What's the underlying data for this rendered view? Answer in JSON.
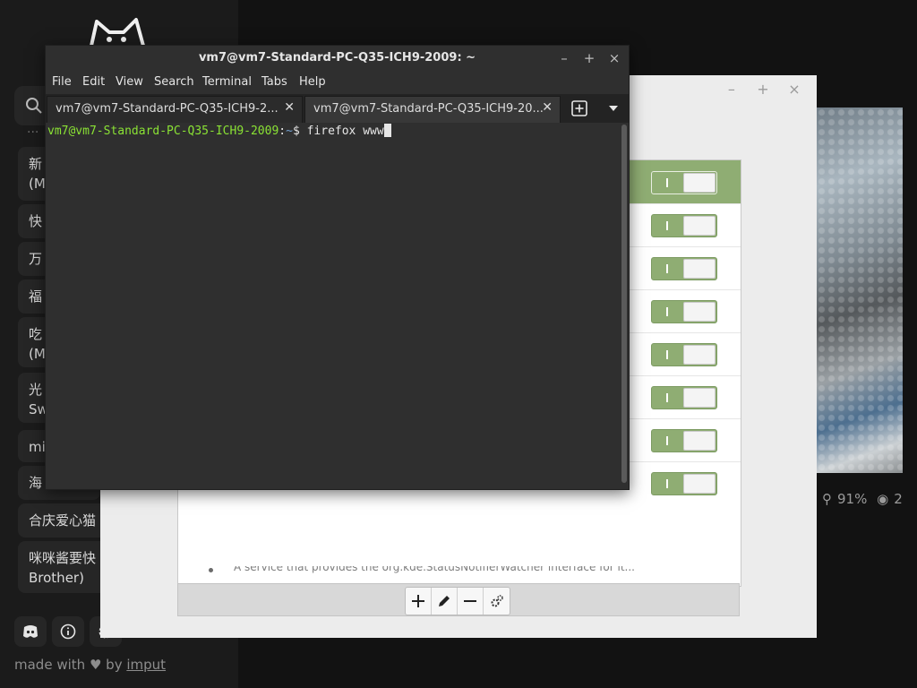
{
  "background_app": {
    "search_hint": "...",
    "sidebar_items": [
      {
        "label": "新\n(M"
      },
      {
        "label": "快"
      },
      {
        "label": "万"
      },
      {
        "label": "福"
      },
      {
        "label": "吃\n(M"
      },
      {
        "label": "光\nSw"
      },
      {
        "label": "mi"
      },
      {
        "label": "海"
      },
      {
        "label": "合庆爱心猫"
      },
      {
        "label": "咪咪酱要快\nBrother)"
      }
    ],
    "footer": {
      "made_with": "made with",
      "by": "by",
      "author_link": "imput"
    },
    "stats": {
      "percent": "91%",
      "views": "2"
    },
    "icons": [
      "cat-logo",
      "search-icon",
      "discord-icon",
      "info-icon",
      "settings-icon",
      "heart-icon",
      "percent-icon",
      "eye-icon"
    ]
  },
  "dialog": {
    "window_controls": {
      "minimize": "–",
      "maximize": "+",
      "close": "×"
    },
    "rows": [
      {
        "selected": true,
        "enabled": true
      },
      {
        "selected": false,
        "enabled": true
      },
      {
        "selected": false,
        "enabled": true
      },
      {
        "selected": false,
        "enabled": true
      },
      {
        "selected": false,
        "enabled": true
      },
      {
        "selected": false,
        "enabled": true
      },
      {
        "selected": false,
        "enabled": true
      },
      {
        "selected": false,
        "enabled": true
      }
    ],
    "description": "A service that provides the org.kde.StatusNotifierWatcher interface for it...",
    "toolbar_icons": [
      "add-icon",
      "edit-icon",
      "remove-icon",
      "configure-icon"
    ]
  },
  "terminal": {
    "title": "vm7@vm7-Standard-PC-Q35-ICH9-2009: ~",
    "window_controls": {
      "minimize": "–",
      "maximize": "+",
      "close": "×"
    },
    "menu": [
      "File",
      "Edit",
      "View",
      "Search",
      "Terminal",
      "Tabs",
      "Help"
    ],
    "tabs": [
      {
        "label": "vm7@vm7-Standard-PC-Q35-ICH9-2...",
        "active": false
      },
      {
        "label": "vm7@vm7-Standard-PC-Q35-ICH9-20...",
        "active": true
      }
    ],
    "prompt": {
      "user_host": "vm7@vm7-Standard-PC-Q35-ICH9-2009",
      "sep": ":",
      "path": "~",
      "symbol": "$",
      "command": "firefox www"
    },
    "colors": {
      "prompt_user": "#8ae234",
      "prompt_path": "#729fcf",
      "background": "#2f2f2f"
    }
  }
}
